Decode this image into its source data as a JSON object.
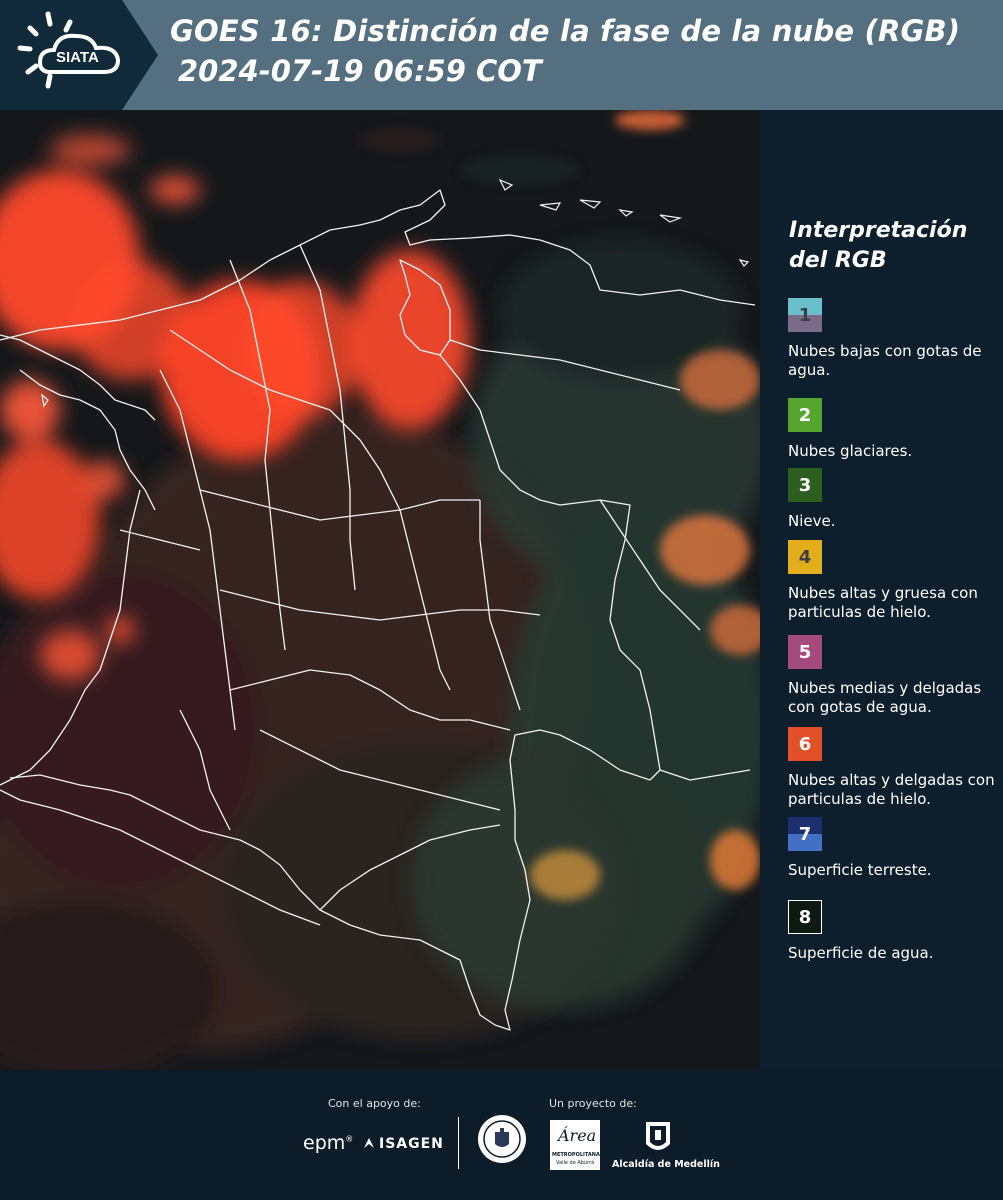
{
  "header": {
    "logo_text": "SIATA",
    "title_line1": "GOES 16: Distinción de la fase de la nube (RGB)",
    "title_line2": "2024-07-19 06:59 COT"
  },
  "legend": {
    "title_line1": "Interpretación",
    "title_line2": "del RGB",
    "items": [
      {
        "number": "1",
        "label": "Nubes bajas con gotas de agua.",
        "color_top": "#6bbfcb",
        "color_bottom": "#7a6c86"
      },
      {
        "number": "2",
        "label": "Nubes glaciares.",
        "color_top": "#55a52f",
        "color_bottom": "#55a52f"
      },
      {
        "number": "3",
        "label": "Nieve.",
        "color_top": "#2b5e1f",
        "color_bottom": "#2b5e1f"
      },
      {
        "number": "4",
        "label": "Nubes altas y gruesa con particulas de hielo.",
        "color_top": "#e2ae1c",
        "color_bottom": "#e2ae1c"
      },
      {
        "number": "5",
        "label": "Nubes medias y delgadas con gotas de agua.",
        "color_top": "#a54a7c",
        "color_bottom": "#a54a7c"
      },
      {
        "number": "6",
        "label": "Nubes altas y delgadas con particulas de hielo.",
        "color_top": "#e2502a",
        "color_bottom": "#e2502a"
      },
      {
        "number": "7",
        "label": "Superficie terreste.",
        "color_top": "#1b2e6e",
        "color_bottom": "#4470c4"
      },
      {
        "number": "8",
        "label": "Superficie de agua.",
        "color_top": "#0d1a12",
        "color_bottom": "#0d1a12"
      }
    ]
  },
  "footer": {
    "support_caption": "Con el apoyo de:",
    "project_caption": "Un proyecto de:",
    "sponsor_epm": "epm",
    "sponsor_isagen": "ISAGEN",
    "area_metropolitana_text": "Área",
    "area_metropolitana_sub": "METROPOLITANA",
    "area_metropolitana_sub2": "Valle de Aburrá",
    "alcaldia_text": "Alcaldía de Medellín"
  }
}
